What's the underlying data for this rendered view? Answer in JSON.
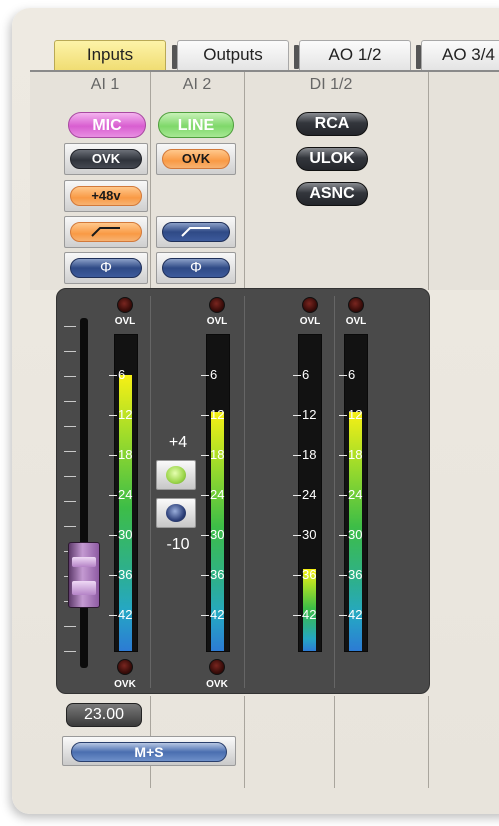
{
  "tabs": [
    {
      "label": "Inputs",
      "active": true
    },
    {
      "label": "Outputs",
      "active": false
    },
    {
      "label": "AO 1/2",
      "active": false
    },
    {
      "label": "AO 3/4",
      "active": false
    }
  ],
  "channels": {
    "ai1": {
      "header": "AI 1",
      "mic_label": "MIC",
      "ovk_label": "OVK",
      "phantom_label": "+48v",
      "hpf_icon": "high-pass-icon",
      "phase_icon": "phase-icon",
      "phase_glyph": "Φ",
      "ovl_top": "OVL",
      "ovk_bottom": "OVK",
      "meter_level": 0.88
    },
    "ai2": {
      "header": "AI 2",
      "line_label": "LINE",
      "ovk_label": "OVK",
      "hpf_icon": "high-pass-icon",
      "phase_icon": "phase-icon",
      "phase_glyph": "Φ",
      "ovl_top": "OVL",
      "ovk_bottom": "OVK",
      "meter_level": 0.76
    },
    "di12": {
      "header": "DI 1/2",
      "rca_label": "RCA",
      "ulok_label": "ULOK",
      "asnc_label": "ASNC",
      "ovl_left": "OVL",
      "ovl_right": "OVL",
      "meter_left_level": 0.26,
      "meter_right_level": 0.76
    }
  },
  "meter_scale": [
    "6",
    "12",
    "18",
    "24",
    "30",
    "36",
    "42"
  ],
  "gain_switch": {
    "high": "+4",
    "low": "-10"
  },
  "fader": {
    "value": "23.00"
  },
  "stereo_mode": {
    "label": "M+S"
  },
  "colors": {
    "tab_active": "#f0dd73",
    "mic": "#e07ad8",
    "line": "#8fe27c",
    "ovk_orange": "#f99a45",
    "meter_panel": "#4a4a4a"
  }
}
